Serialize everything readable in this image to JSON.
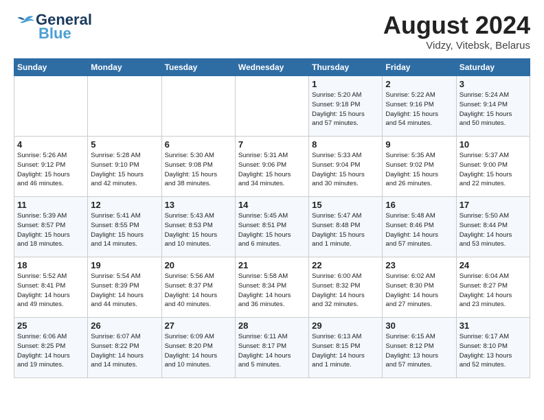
{
  "header": {
    "logo_general": "General",
    "logo_blue": "Blue",
    "title": "August 2024",
    "subtitle": "Vidzy, Vitebsk, Belarus"
  },
  "weekdays": [
    "Sunday",
    "Monday",
    "Tuesday",
    "Wednesday",
    "Thursday",
    "Friday",
    "Saturday"
  ],
  "weeks": [
    [
      {
        "day": "",
        "info": ""
      },
      {
        "day": "",
        "info": ""
      },
      {
        "day": "",
        "info": ""
      },
      {
        "day": "",
        "info": ""
      },
      {
        "day": "1",
        "info": "Sunrise: 5:20 AM\nSunset: 9:18 PM\nDaylight: 15 hours\nand 57 minutes."
      },
      {
        "day": "2",
        "info": "Sunrise: 5:22 AM\nSunset: 9:16 PM\nDaylight: 15 hours\nand 54 minutes."
      },
      {
        "day": "3",
        "info": "Sunrise: 5:24 AM\nSunset: 9:14 PM\nDaylight: 15 hours\nand 50 minutes."
      }
    ],
    [
      {
        "day": "4",
        "info": "Sunrise: 5:26 AM\nSunset: 9:12 PM\nDaylight: 15 hours\nand 46 minutes."
      },
      {
        "day": "5",
        "info": "Sunrise: 5:28 AM\nSunset: 9:10 PM\nDaylight: 15 hours\nand 42 minutes."
      },
      {
        "day": "6",
        "info": "Sunrise: 5:30 AM\nSunset: 9:08 PM\nDaylight: 15 hours\nand 38 minutes."
      },
      {
        "day": "7",
        "info": "Sunrise: 5:31 AM\nSunset: 9:06 PM\nDaylight: 15 hours\nand 34 minutes."
      },
      {
        "day": "8",
        "info": "Sunrise: 5:33 AM\nSunset: 9:04 PM\nDaylight: 15 hours\nand 30 minutes."
      },
      {
        "day": "9",
        "info": "Sunrise: 5:35 AM\nSunset: 9:02 PM\nDaylight: 15 hours\nand 26 minutes."
      },
      {
        "day": "10",
        "info": "Sunrise: 5:37 AM\nSunset: 9:00 PM\nDaylight: 15 hours\nand 22 minutes."
      }
    ],
    [
      {
        "day": "11",
        "info": "Sunrise: 5:39 AM\nSunset: 8:57 PM\nDaylight: 15 hours\nand 18 minutes."
      },
      {
        "day": "12",
        "info": "Sunrise: 5:41 AM\nSunset: 8:55 PM\nDaylight: 15 hours\nand 14 minutes."
      },
      {
        "day": "13",
        "info": "Sunrise: 5:43 AM\nSunset: 8:53 PM\nDaylight: 15 hours\nand 10 minutes."
      },
      {
        "day": "14",
        "info": "Sunrise: 5:45 AM\nSunset: 8:51 PM\nDaylight: 15 hours\nand 6 minutes."
      },
      {
        "day": "15",
        "info": "Sunrise: 5:47 AM\nSunset: 8:48 PM\nDaylight: 15 hours\nand 1 minute."
      },
      {
        "day": "16",
        "info": "Sunrise: 5:48 AM\nSunset: 8:46 PM\nDaylight: 14 hours\nand 57 minutes."
      },
      {
        "day": "17",
        "info": "Sunrise: 5:50 AM\nSunset: 8:44 PM\nDaylight: 14 hours\nand 53 minutes."
      }
    ],
    [
      {
        "day": "18",
        "info": "Sunrise: 5:52 AM\nSunset: 8:41 PM\nDaylight: 14 hours\nand 49 minutes."
      },
      {
        "day": "19",
        "info": "Sunrise: 5:54 AM\nSunset: 8:39 PM\nDaylight: 14 hours\nand 44 minutes."
      },
      {
        "day": "20",
        "info": "Sunrise: 5:56 AM\nSunset: 8:37 PM\nDaylight: 14 hours\nand 40 minutes."
      },
      {
        "day": "21",
        "info": "Sunrise: 5:58 AM\nSunset: 8:34 PM\nDaylight: 14 hours\nand 36 minutes."
      },
      {
        "day": "22",
        "info": "Sunrise: 6:00 AM\nSunset: 8:32 PM\nDaylight: 14 hours\nand 32 minutes."
      },
      {
        "day": "23",
        "info": "Sunrise: 6:02 AM\nSunset: 8:30 PM\nDaylight: 14 hours\nand 27 minutes."
      },
      {
        "day": "24",
        "info": "Sunrise: 6:04 AM\nSunset: 8:27 PM\nDaylight: 14 hours\nand 23 minutes."
      }
    ],
    [
      {
        "day": "25",
        "info": "Sunrise: 6:06 AM\nSunset: 8:25 PM\nDaylight: 14 hours\nand 19 minutes."
      },
      {
        "day": "26",
        "info": "Sunrise: 6:07 AM\nSunset: 8:22 PM\nDaylight: 14 hours\nand 14 minutes."
      },
      {
        "day": "27",
        "info": "Sunrise: 6:09 AM\nSunset: 8:20 PM\nDaylight: 14 hours\nand 10 minutes."
      },
      {
        "day": "28",
        "info": "Sunrise: 6:11 AM\nSunset: 8:17 PM\nDaylight: 14 hours\nand 5 minutes."
      },
      {
        "day": "29",
        "info": "Sunrise: 6:13 AM\nSunset: 8:15 PM\nDaylight: 14 hours\nand 1 minute."
      },
      {
        "day": "30",
        "info": "Sunrise: 6:15 AM\nSunset: 8:12 PM\nDaylight: 13 hours\nand 57 minutes."
      },
      {
        "day": "31",
        "info": "Sunrise: 6:17 AM\nSunset: 8:10 PM\nDaylight: 13 hours\nand 52 minutes."
      }
    ]
  ]
}
